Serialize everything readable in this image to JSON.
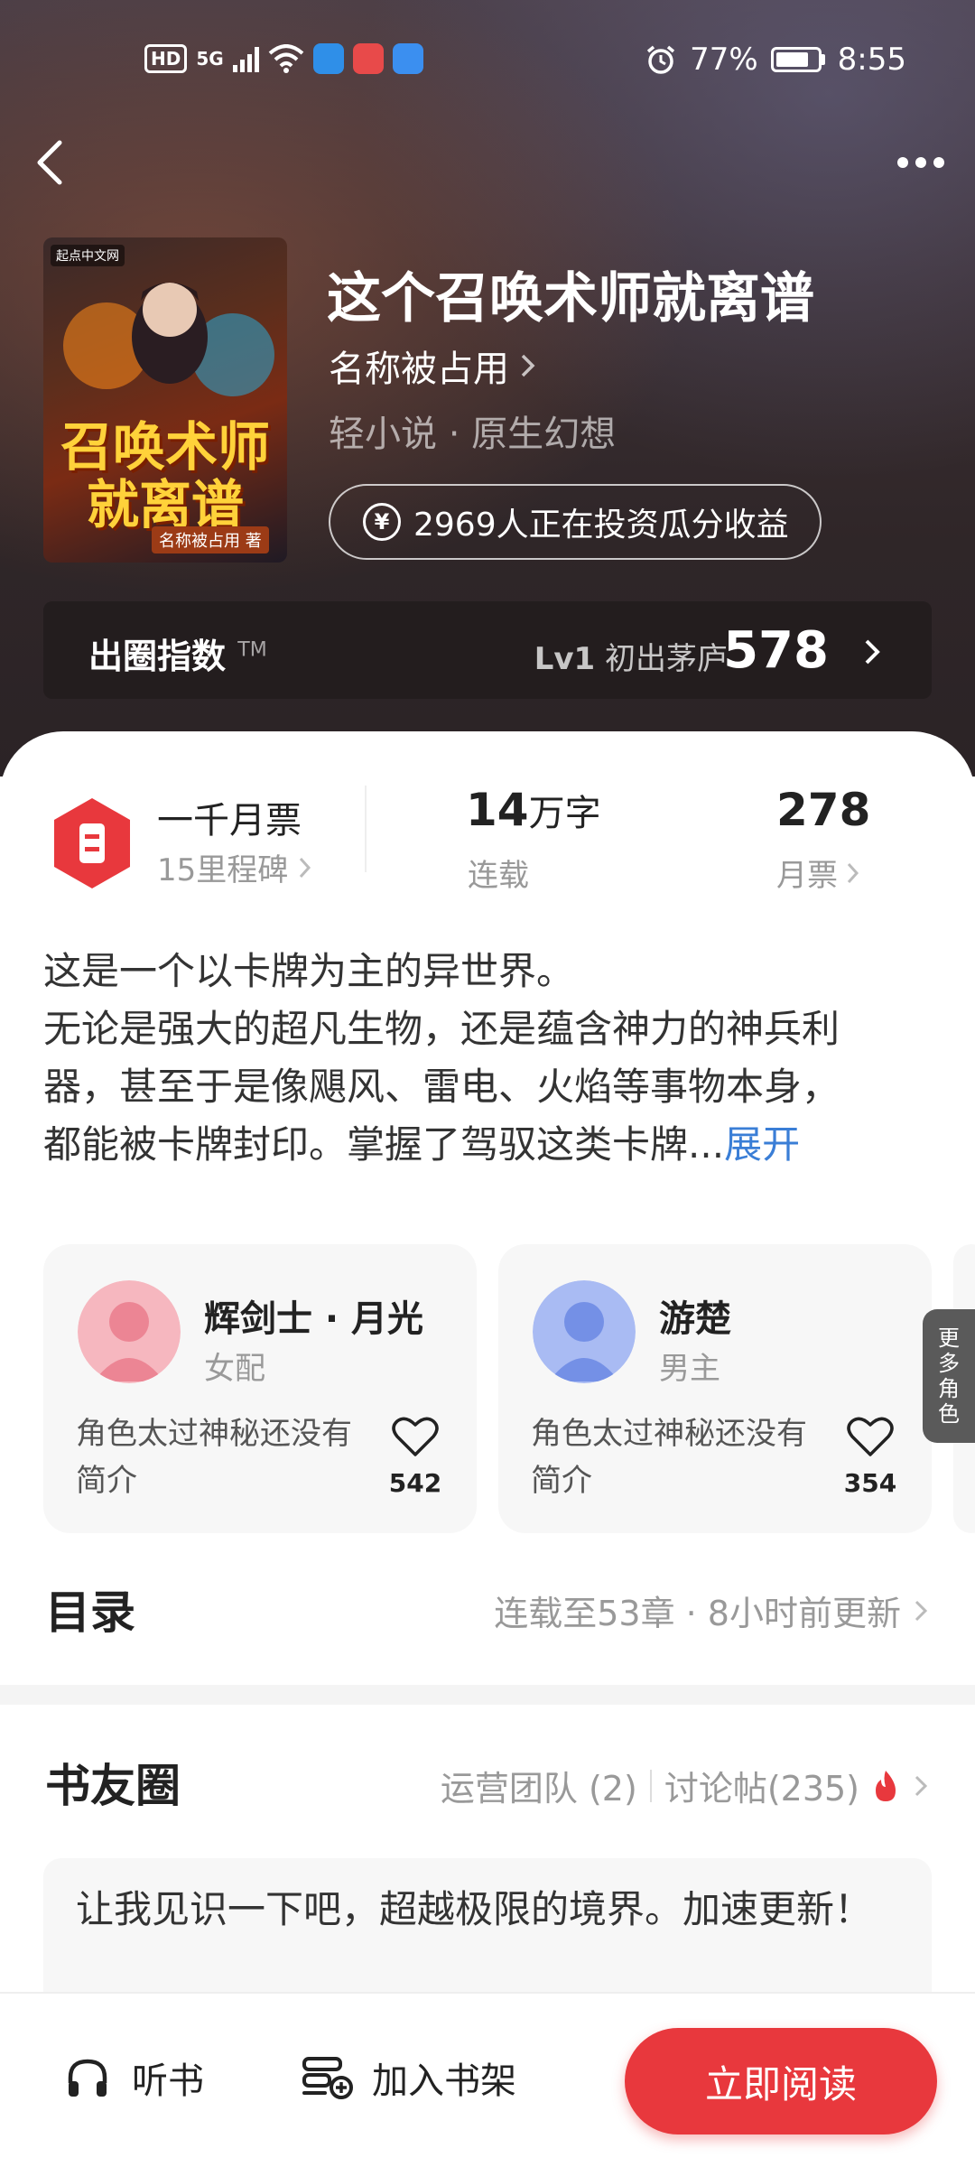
{
  "status_bar": {
    "hd": "HD",
    "network": "5G",
    "battery_percent": "77%",
    "time": "8:55"
  },
  "book": {
    "title": "这个召唤术师就离谱",
    "author": "名称被占用",
    "genre": "轻小说 · 原生幻想",
    "invest_text": "2969人正在投资瓜分收益",
    "cover": {
      "tag": "起点中文网",
      "title": "召唤术师就离谱",
      "author_chip": "名称被占用 著"
    }
  },
  "circle_index": {
    "title": "出圈指数",
    "tm": "TM",
    "level": "Lv1",
    "level_name": "初出茅庐",
    "score": "578"
  },
  "stats": {
    "milestone_title": "一千月票",
    "milestone_sub": "15里程碑",
    "words_value": "14",
    "words_unit": "万字",
    "words_label": "连载",
    "tickets_value": "278",
    "tickets_label": "月票"
  },
  "description": {
    "line1": "这是一个以卡牌为主的异世界。",
    "line2": "无论是强大的超凡生物，还是蕴含神力的神兵利",
    "line3": "器，甚至于是像飓风、雷电、火焰等事物本身，",
    "line4": "都能被卡牌封印。掌握了驾驭这类卡牌...",
    "expand": "展开"
  },
  "roles": [
    {
      "name": "辉剑士 · 月光",
      "type": "女配",
      "desc": "角色太过神秘还没有简介",
      "likes": "542",
      "avatar_color": "#f4a3ad"
    },
    {
      "name": "游楚",
      "type": "男主",
      "desc": "角色太过神秘还没有简介",
      "likes": "354",
      "avatar_color": "#93a9ee"
    }
  ],
  "more_roles": "更多角色",
  "toc": {
    "title": "目录",
    "info": "连载至53章 · 8小时前更新"
  },
  "circle": {
    "title": "书友圈",
    "ops": "运营团队 (2)",
    "posts": "讨论帖(235)"
  },
  "post_preview": "让我见识一下吧，超越极限的境界。加速更新！",
  "bottom_bar": {
    "listen": "听书",
    "shelf": "加入书架",
    "read": "立即阅读"
  },
  "colors": {
    "accent": "#e8383d",
    "link": "#3a7ed6"
  }
}
